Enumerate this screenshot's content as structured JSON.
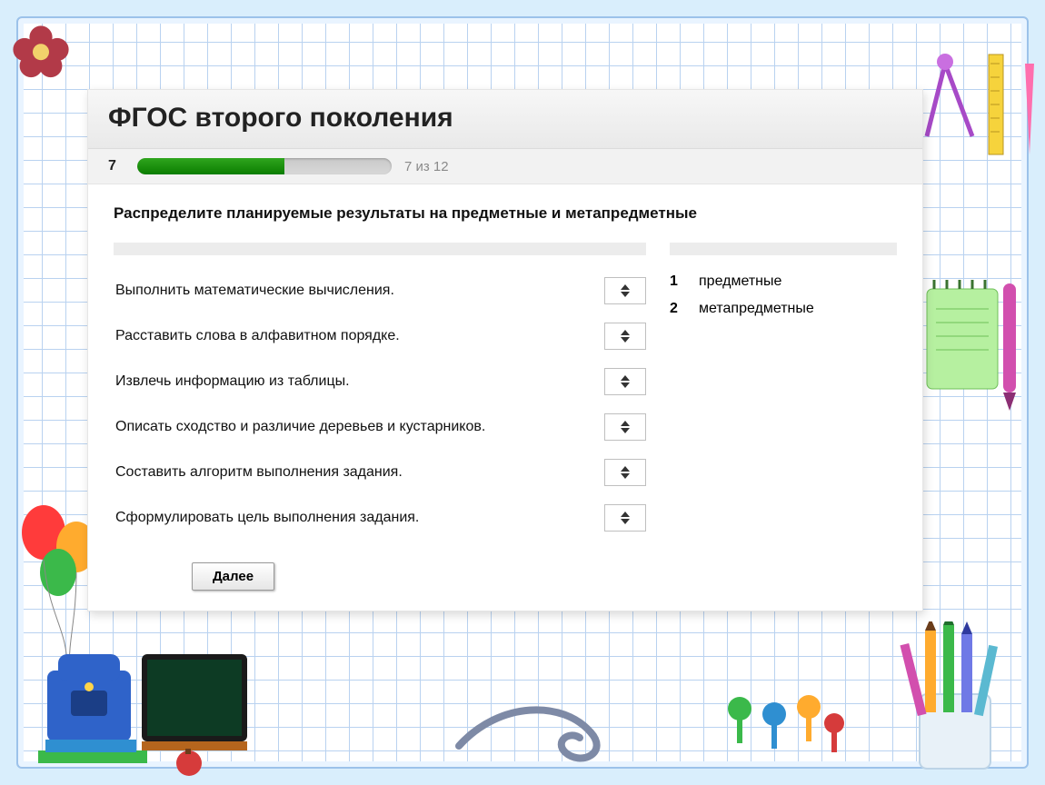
{
  "quiz": {
    "title": "ФГОС второго поколения",
    "progress": {
      "current": 7,
      "total": 12,
      "label": "7 из 12",
      "percent": 58
    },
    "question": "Распределите планируемые результаты на предметные и метапредметные",
    "items": [
      {
        "text": "Выполнить математические вычисления."
      },
      {
        "text": "Расставить слова в алфавитном порядке."
      },
      {
        "text": "Извлечь информацию из таблицы."
      },
      {
        "text": "Описать сходство и различие деревьев и кустарников."
      },
      {
        "text": "Составить алгоритм выполнения задания."
      },
      {
        "text": "Сформулировать цель выполнения задания."
      }
    ],
    "categories": [
      {
        "num": "1",
        "label": "предметные"
      },
      {
        "num": "2",
        "label": "метапредметные"
      }
    ],
    "next_label": "Далее"
  }
}
